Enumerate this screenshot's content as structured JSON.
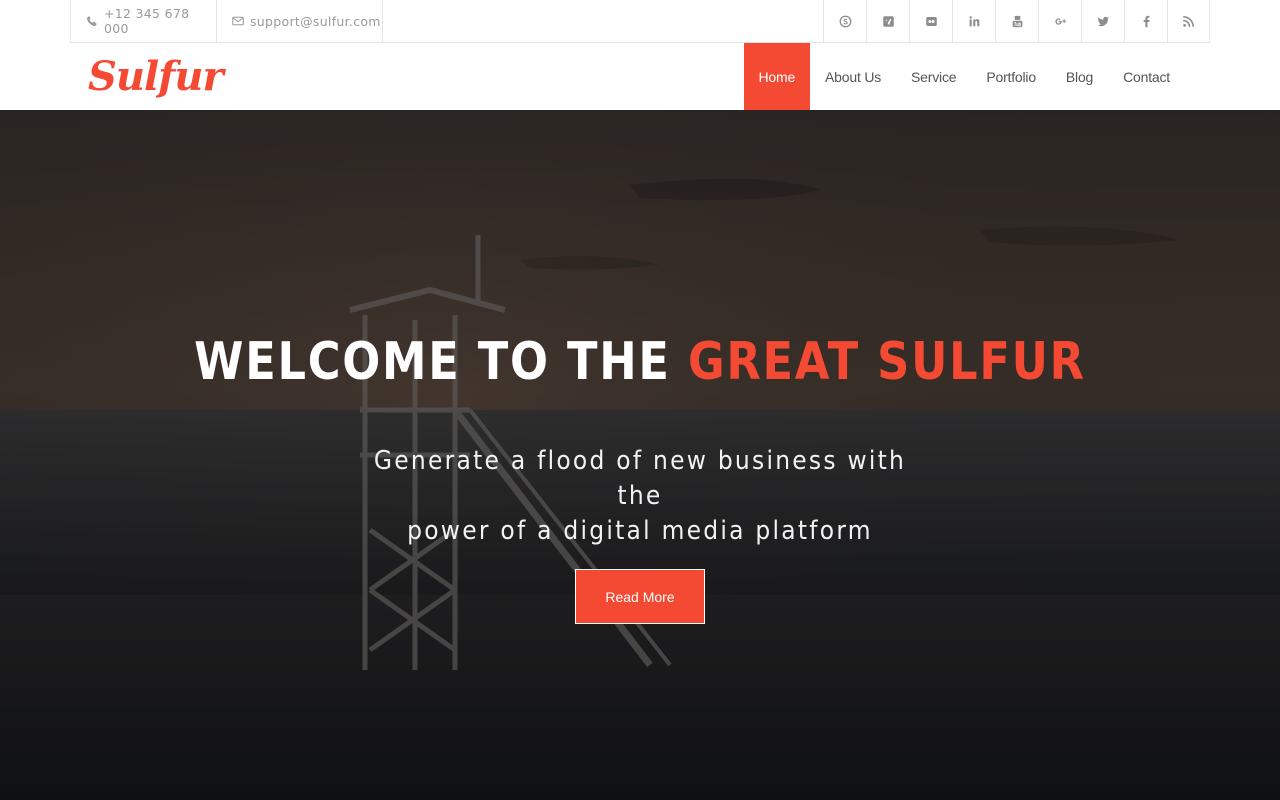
{
  "contact": {
    "phone": "+12 345 678 000",
    "email": "support@sulfur.com"
  },
  "social": [
    {
      "name": "skype-icon"
    },
    {
      "name": "vimeo-icon"
    },
    {
      "name": "flickr-icon"
    },
    {
      "name": "linkedin-icon"
    },
    {
      "name": "youtube-icon"
    },
    {
      "name": "google-plus-icon"
    },
    {
      "name": "twitter-icon"
    },
    {
      "name": "facebook-icon"
    },
    {
      "name": "rss-icon"
    }
  ],
  "brand": {
    "logo_text": "Sulfur",
    "accent_color": "#f44a33"
  },
  "nav": {
    "items": [
      {
        "label": "Home",
        "active": true
      },
      {
        "label": "About Us"
      },
      {
        "label": "Service"
      },
      {
        "label": "Portfolio"
      },
      {
        "label": "Blog"
      },
      {
        "label": "Contact"
      }
    ]
  },
  "hero": {
    "title_white": "WELCOME TO THE ",
    "title_accent": "GREAT SULFUR",
    "subtitle_line1": "Generate a flood of new business with the",
    "subtitle_line2": "power of a digital media platform",
    "cta_label": "Read More"
  }
}
